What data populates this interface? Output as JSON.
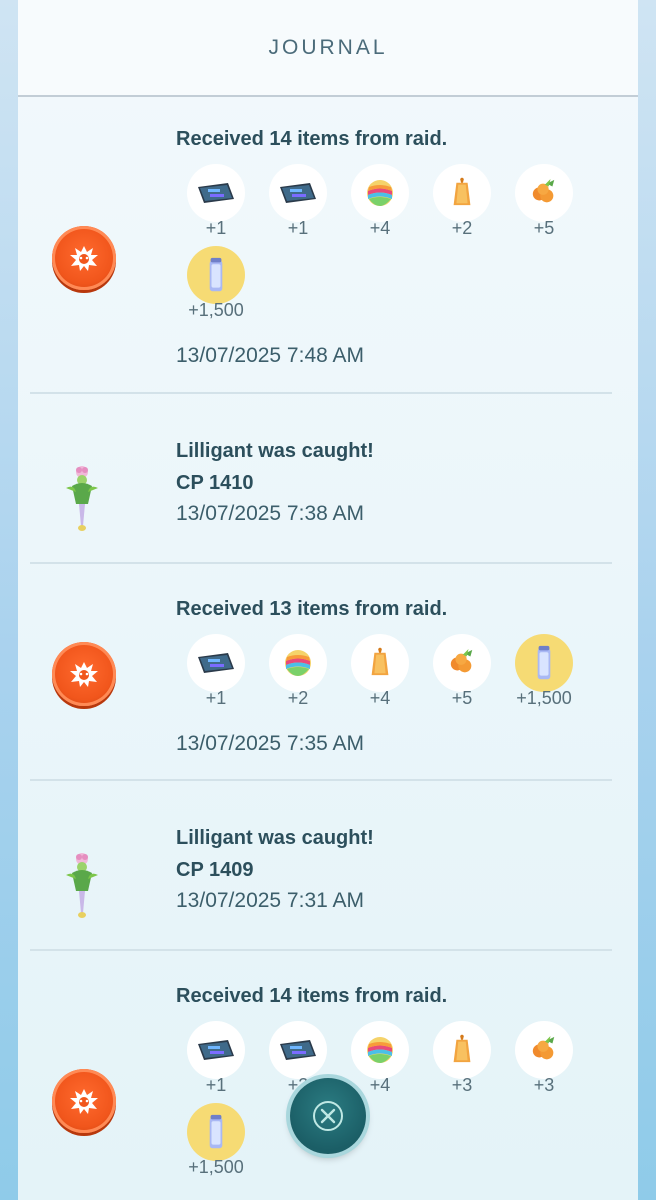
{
  "header": {
    "title": "JOURNAL"
  },
  "colors": {
    "raid_orange": "#f1561c",
    "text_dark": "#2c4f5c",
    "gold_highlight": "#f6db74",
    "fab_teal": "#1b5e66"
  },
  "entries": [
    {
      "type": "raid",
      "icon": "raid-egg-icon",
      "title": "Received 14 items from raid.",
      "items": [
        {
          "icon": "tm-disc-icon",
          "count": "+1",
          "highlight": false
        },
        {
          "icon": "tm-disc-icon",
          "count": "+1",
          "highlight": false
        },
        {
          "icon": "rare-candy-icon",
          "count": "+4",
          "highlight": false
        },
        {
          "icon": "golden-berry-icon",
          "count": "+2",
          "highlight": false
        },
        {
          "icon": "pinap-berry-icon",
          "count": "+5",
          "highlight": false
        },
        {
          "icon": "stardust-icon",
          "count": "+1,500",
          "highlight": true
        }
      ],
      "time": "13/07/2025 7:48 AM"
    },
    {
      "type": "catch",
      "icon": "lilligant-icon",
      "title": "Lilligant was caught!",
      "cp": "CP 1410",
      "time": "13/07/2025 7:38 AM"
    },
    {
      "type": "raid",
      "icon": "raid-egg-icon",
      "title": "Received 13 items from raid.",
      "items": [
        {
          "icon": "tm-disc-icon",
          "count": "+1",
          "highlight": false
        },
        {
          "icon": "rare-candy-icon",
          "count": "+2",
          "highlight": false
        },
        {
          "icon": "golden-berry-icon",
          "count": "+4",
          "highlight": false
        },
        {
          "icon": "pinap-berry-icon",
          "count": "+5",
          "highlight": false
        },
        {
          "icon": "stardust-icon",
          "count": "+1,500",
          "highlight": true
        }
      ],
      "time": "13/07/2025 7:35 AM"
    },
    {
      "type": "catch",
      "icon": "lilligant-icon",
      "title": "Lilligant was caught!",
      "cp": "CP 1409",
      "time": "13/07/2025 7:31 AM"
    },
    {
      "type": "raid",
      "icon": "raid-egg-icon",
      "title": "Received 14 items from raid.",
      "items": [
        {
          "icon": "tm-disc-icon",
          "count": "+1",
          "highlight": false
        },
        {
          "icon": "tm-disc-icon",
          "count": "+2",
          "highlight": false
        },
        {
          "icon": "rare-candy-icon",
          "count": "+4",
          "highlight": false
        },
        {
          "icon": "golden-berry-icon",
          "count": "+3",
          "highlight": false
        },
        {
          "icon": "pinap-berry-icon",
          "count": "+3",
          "highlight": false
        },
        {
          "icon": "stardust-icon",
          "count": "+1,500",
          "highlight": true
        }
      ],
      "time": ""
    }
  ],
  "close_button": {
    "icon": "close-icon"
  }
}
